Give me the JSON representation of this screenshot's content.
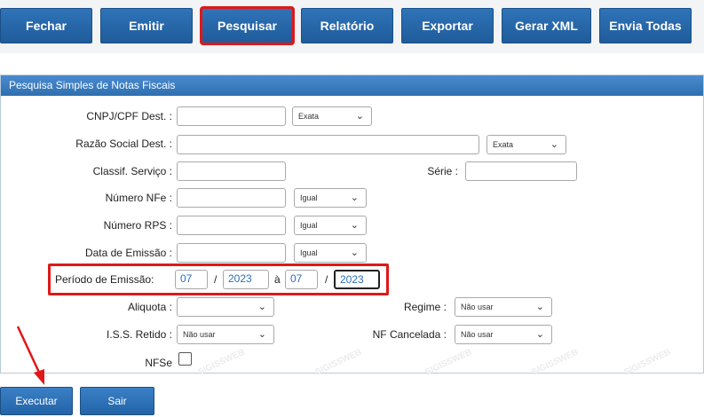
{
  "toolbar": {
    "fechar": "Fechar",
    "emitir": "Emitir",
    "pesquisar": "Pesquisar",
    "relatorio": "Relatório",
    "exportar": "Exportar",
    "gerar_xml": "Gerar XML",
    "envia_todas": "Envia Todas"
  },
  "panel": {
    "title": "Pesquisa Simples de Notas Fiscais"
  },
  "form": {
    "cnpj_label": "CNPJ/CPF Dest. :",
    "cnpj_mode": "Exata",
    "razao_label": "Razão Social Dest. :",
    "razao_mode": "Exata",
    "classif_label": "Classif. Serviço :",
    "serie_label": "Série :",
    "nfe_label": "Número NFe :",
    "nfe_mode": "Igual",
    "rps_label": "Número RPS :",
    "rps_mode": "Igual",
    "data_label": "Data de Emissão :",
    "data_mode": "Igual",
    "periodo_label": "Período de Emissão:",
    "periodo_mes_ini": "07",
    "periodo_ano_ini": "2023",
    "periodo_a": "à",
    "periodo_mes_fim": "07",
    "periodo_ano_fim": "2023",
    "slash": "/",
    "aliquota_label": "Aliquota :",
    "aliquota_value": "",
    "regime_label": "Regime :",
    "regime_value": "Não usar",
    "iss_label": "I.S.S. Retido :",
    "iss_value": "Não usar",
    "nfcancelada_label": "NF Cancelada :",
    "nfcancelada_value": "Não usar",
    "nfse_label": "NFSe"
  },
  "buttons": {
    "executar": "Executar",
    "sair": "Sair"
  },
  "watermark": "SIGISSWEB",
  "colors": {
    "toolbar_button": "#2a6cae",
    "highlight": "#e01818",
    "panel_header": "#3b7dc0"
  }
}
